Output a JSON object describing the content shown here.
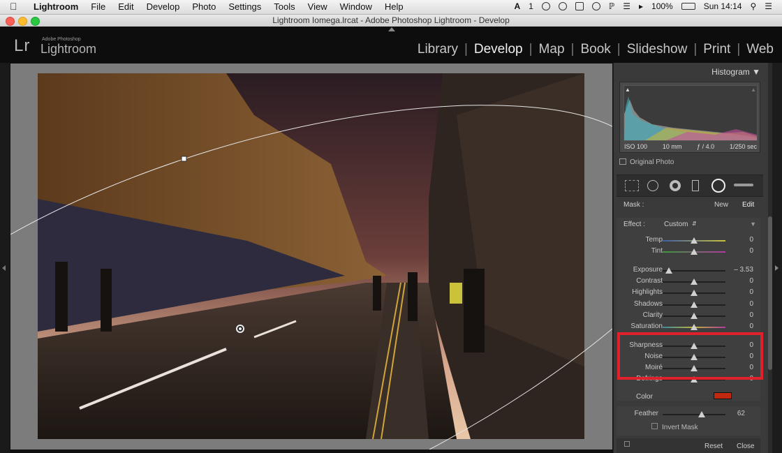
{
  "menubar": {
    "app": "Lightroom",
    "items": [
      "File",
      "Edit",
      "Develop",
      "Photo",
      "Settings",
      "Tools",
      "View",
      "Window",
      "Help"
    ],
    "status": {
      "battery": "100%",
      "clock": "Sun 14:14",
      "a_count": "1"
    }
  },
  "titlebar": {
    "title": "Lightroom    Iomega.lrcat - Adobe Photoshop Lightroom - Develop"
  },
  "header": {
    "logo_mark": "Lr",
    "logo_small": "Adobe Photoshop",
    "logo_name": "Lightroom",
    "modules": [
      "Library",
      "Develop",
      "Map",
      "Book",
      "Slideshow",
      "Print",
      "Web"
    ],
    "active_module": "Develop"
  },
  "panel": {
    "histogram_title": "Histogram",
    "info": {
      "iso": "ISO 100",
      "focal": "10 mm",
      "aperture": "ƒ / 4.0",
      "shutter": "1/250 sec"
    },
    "original_photo": "Original Photo",
    "mask_label": "Mask :",
    "mask_new": "New",
    "mask_edit": "Edit",
    "effect_label": "Effect :",
    "effect_value": "Custom",
    "sliders": [
      {
        "label": "Temp",
        "value": "0",
        "pos": 0.5
      },
      {
        "label": "Tint",
        "value": "0",
        "pos": 0.5
      },
      {
        "label": "Exposure",
        "value": "– 3.53",
        "pos": 0.1
      },
      {
        "label": "Contrast",
        "value": "0",
        "pos": 0.5
      },
      {
        "label": "Highlights",
        "value": "0",
        "pos": 0.5
      },
      {
        "label": "Shadows",
        "value": "0",
        "pos": 0.5
      },
      {
        "label": "Clarity",
        "value": "0",
        "pos": 0.5
      },
      {
        "label": "Saturation",
        "value": "0",
        "pos": 0.5
      },
      {
        "label": "Sharpness",
        "value": "0",
        "pos": 0.5
      },
      {
        "label": "Noise",
        "value": "0",
        "pos": 0.5
      },
      {
        "label": "Moiré",
        "value": "0",
        "pos": 0.5
      },
      {
        "label": "Defringe",
        "value": "0",
        "pos": 0.5
      }
    ],
    "color_label": "Color",
    "color_swatch": "#c0280f",
    "feather_label": "Feather",
    "feather_value": "62",
    "feather_pos": 0.62,
    "invert_mask": "Invert Mask",
    "reset": "Reset",
    "close": "Close"
  },
  "colors": {
    "highlight": "#e0212a",
    "panel": "#3a3a3a"
  }
}
